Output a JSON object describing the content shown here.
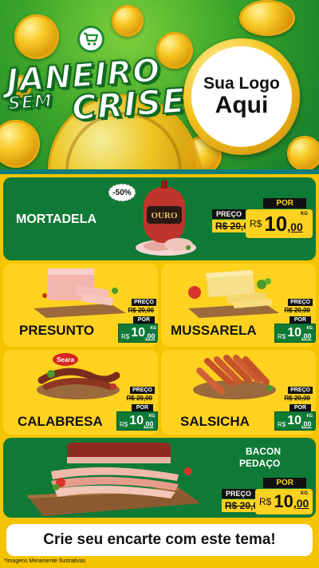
{
  "header": {
    "campaign_line1": "JANEIRO",
    "campaign_line2a": "SEM",
    "campaign_line2b": "CRISE",
    "logo_line1": "Sua Logo",
    "logo_line2": "Aqui",
    "cart_icon": "shopping-cart-icon"
  },
  "colors": {
    "brand_green": "#0f7a36",
    "brand_yellow": "#ffd21f",
    "divider_teal": "#0c7d7a"
  },
  "featured": {
    "name": "MORTADELA",
    "discount_badge": "-50%",
    "brand_on_pack": "OURO",
    "preco_label": "PREÇO",
    "old_price": "R$ 20,00",
    "por_label": "POR",
    "currency": "R$",
    "price_int": "10",
    "price_cents": ",00",
    "unit": "KG"
  },
  "products": [
    {
      "name": "PRESUNTO",
      "preco_label": "PREÇO",
      "old_price": "R$ 20,00",
      "por_label": "POR",
      "currency": "R$",
      "price_int": "10",
      "price_cents": ",00",
      "unit": "KG"
    },
    {
      "name": "MUSSARELA",
      "preco_label": "PREÇO",
      "old_price": "R$ 20,00",
      "por_label": "POR",
      "currency": "R$",
      "price_int": "10",
      "price_cents": ",00",
      "unit": "KG"
    },
    {
      "name": "CALABRESA",
      "brand": "Seara",
      "preco_label": "PREÇO",
      "old_price": "R$ 20,00",
      "por_label": "POR",
      "currency": "R$",
      "price_int": "10",
      "price_cents": ",00",
      "unit": "KG"
    },
    {
      "name": "SALSICHA",
      "preco_label": "PREÇO",
      "old_price": "R$ 20,00",
      "por_label": "POR",
      "currency": "R$",
      "price_int": "10",
      "price_cents": ",00",
      "unit": "KG"
    }
  ],
  "bacon": {
    "name_line1": "BACON",
    "name_line2": "PEDAÇO",
    "preco_label": "PREÇO",
    "old_price": "R$ 20,00",
    "por_label": "POR",
    "currency": "R$",
    "price_int": "10",
    "price_cents": ",00",
    "unit": "KG"
  },
  "cta": {
    "text": "Crie seu encarte com este tema!"
  },
  "footnote": "*Imagens Meramente Ilustrativas"
}
